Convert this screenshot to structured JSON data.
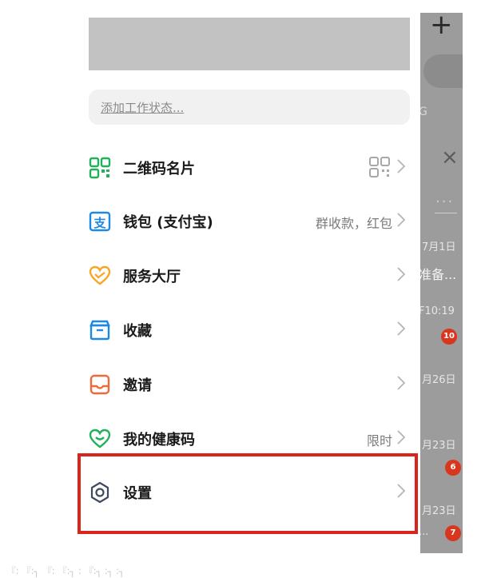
{
  "drawer": {
    "status_placeholder": "添加工作状态...",
    "menu": [
      {
        "label": "二维码名片",
        "icon": "qr-code-icon",
        "extra": ""
      },
      {
        "label": "钱包 (支付宝)",
        "icon": "wallet-icon",
        "extra": "群收款，红包"
      },
      {
        "label": "服务大厅",
        "icon": "heart-service-icon",
        "extra": ""
      },
      {
        "label": "收藏",
        "icon": "favorites-box-icon",
        "extra": ""
      },
      {
        "label": "邀请",
        "icon": "invite-icon",
        "extra": ""
      },
      {
        "label": "我的健康码",
        "icon": "health-code-icon",
        "extra": "限时"
      },
      {
        "label": "设置",
        "icon": "settings-gear-icon",
        "extra": ""
      }
    ]
  },
  "background_app": {
    "plus": "+",
    "dates": [
      "7月1日",
      "准备...",
      "F10:19",
      "月26日",
      "月23日",
      "月23日",
      "..."
    ],
    "badges": [
      "10",
      "6",
      "7"
    ]
  },
  "footer_faint": "『∶ 『∶┐ 『∶ 『∶┐ ∶ 『∶┐ ∶┐ ∶┐"
}
